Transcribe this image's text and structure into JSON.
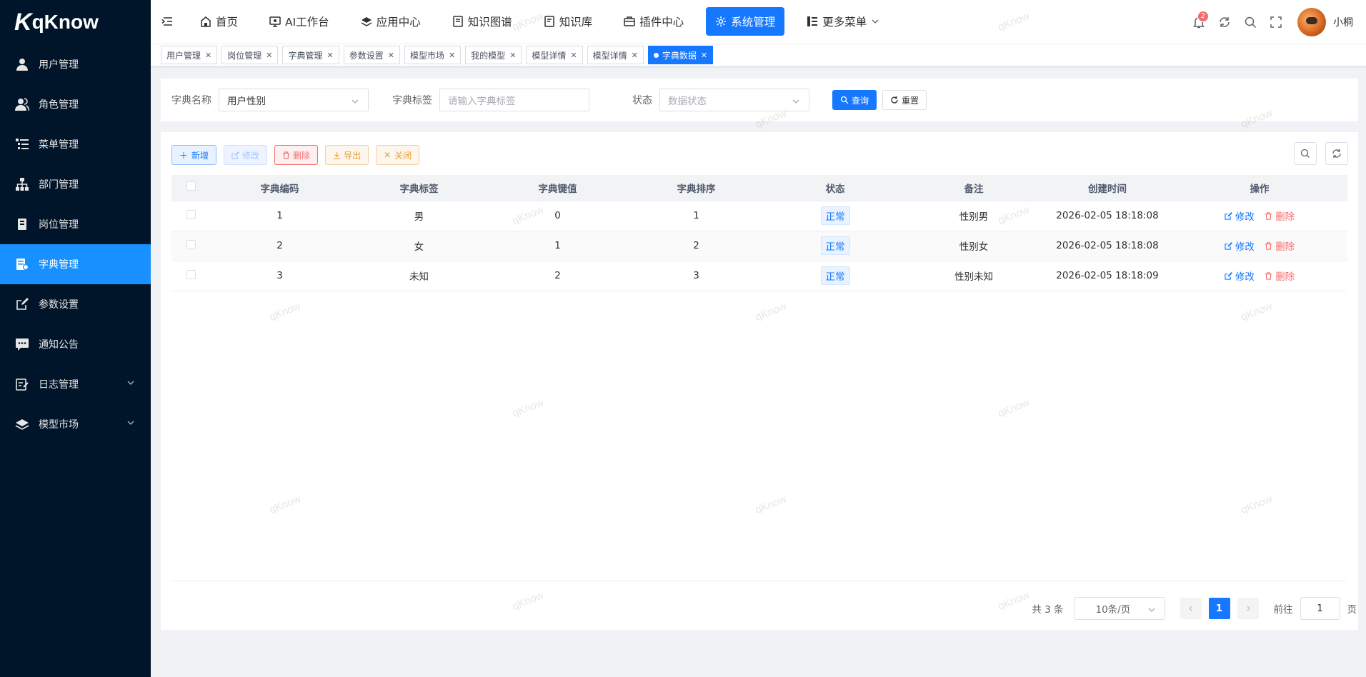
{
  "app": {
    "logo_mark": "K",
    "logo_text": "qKnow",
    "watermark": "qKnow"
  },
  "sidebar": {
    "items": [
      {
        "label": "用户管理",
        "icon": "user-icon"
      },
      {
        "label": "角色管理",
        "icon": "users-icon"
      },
      {
        "label": "菜单管理",
        "icon": "tree-list-icon"
      },
      {
        "label": "部门管理",
        "icon": "org-chart-icon"
      },
      {
        "label": "岗位管理",
        "icon": "post-icon"
      },
      {
        "label": "字典管理",
        "icon": "dictionary-icon",
        "active": true
      },
      {
        "label": "参数设置",
        "icon": "edit-icon"
      },
      {
        "label": "通知公告",
        "icon": "message-icon"
      },
      {
        "label": "日志管理",
        "icon": "log-icon",
        "expandable": true
      },
      {
        "label": "模型市场",
        "icon": "model-icon",
        "expandable": true
      }
    ]
  },
  "topnav": {
    "items": [
      {
        "label": "首页",
        "icon": "home-icon"
      },
      {
        "label": "AI工作台",
        "icon": "monitor-icon"
      },
      {
        "label": "应用中心",
        "icon": "stack-icon"
      },
      {
        "label": "知识图谱",
        "icon": "document-icon"
      },
      {
        "label": "知识库",
        "icon": "book-icon"
      },
      {
        "label": "插件中心",
        "icon": "briefcase-icon"
      },
      {
        "label": "系统管理",
        "icon": "gear-icon",
        "active": true
      },
      {
        "label": "更多菜单",
        "icon": "menu-icon"
      }
    ]
  },
  "header": {
    "notification_count": "2",
    "username": "小桐"
  },
  "tabs": [
    {
      "label": "用户管理"
    },
    {
      "label": "岗位管理"
    },
    {
      "label": "字典管理"
    },
    {
      "label": "参数设置"
    },
    {
      "label": "模型市场"
    },
    {
      "label": "我的模型"
    },
    {
      "label": "模型详情"
    },
    {
      "label": "模型详情"
    },
    {
      "label": "字典数据",
      "active": true
    }
  ],
  "search": {
    "dict_name_label": "字典名称",
    "dict_name_value": "用户性别",
    "dict_label_label": "字典标签",
    "dict_label_placeholder": "请输入字典标签",
    "status_label": "状态",
    "status_placeholder": "数据状态",
    "query_label": "查询",
    "reset_label": "重置"
  },
  "toolbar": {
    "add": "新增",
    "edit": "修改",
    "delete": "删除",
    "export": "导出",
    "close": "关闭"
  },
  "table": {
    "columns": [
      "字典编码",
      "字典标签",
      "字典键值",
      "字典排序",
      "状态",
      "备注",
      "创建时间",
      "操作"
    ],
    "rows": [
      {
        "code": "1",
        "label": "男",
        "value": "0",
        "sort": "1",
        "status": "正常",
        "remark": "性别男",
        "created": "2026-02-05 18:18:08"
      },
      {
        "code": "2",
        "label": "女",
        "value": "1",
        "sort": "2",
        "status": "正常",
        "remark": "性别女",
        "created": "2026-02-05 18:18:08"
      },
      {
        "code": "3",
        "label": "未知",
        "value": "2",
        "sort": "3",
        "status": "正常",
        "remark": "性别未知",
        "created": "2026-02-05 18:18:09"
      }
    ],
    "edit_label": "修改",
    "delete_label": "删除"
  },
  "pagination": {
    "total": "共 3 条",
    "page_size": "10条/页",
    "current": "1",
    "goto_label": "前往",
    "goto_value": "1",
    "page_suffix": "页"
  }
}
